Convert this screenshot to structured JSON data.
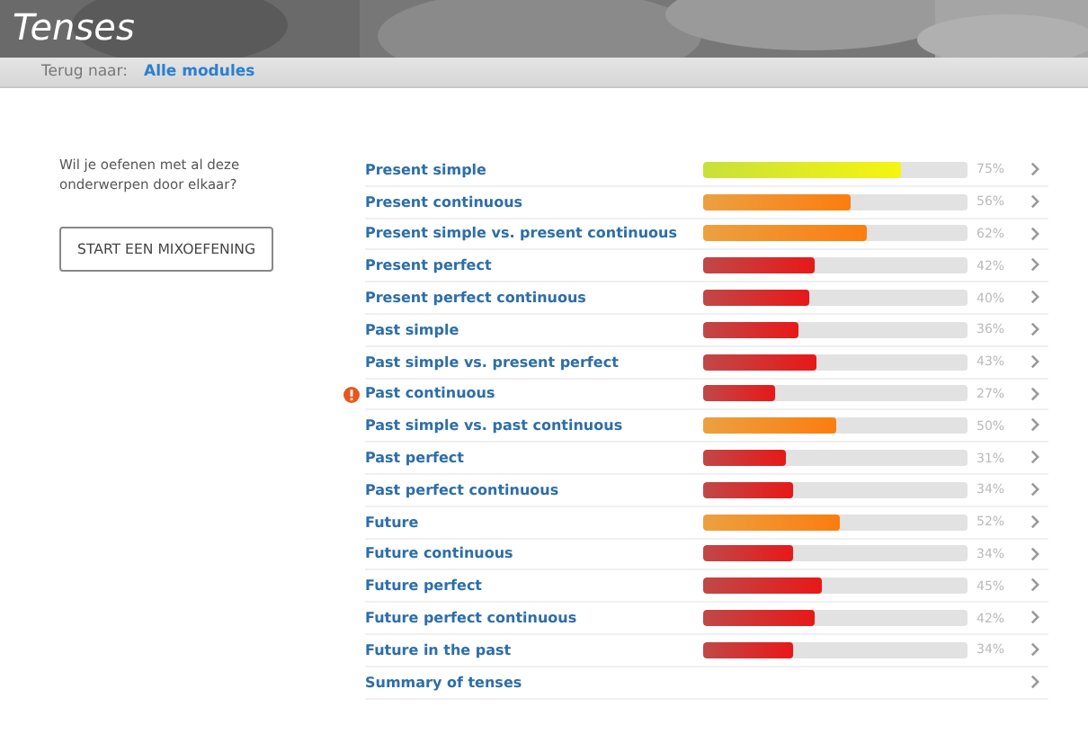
{
  "header": {
    "title": "Tenses"
  },
  "breadcrumb": {
    "label": "Terug naar:",
    "link": "Alle modules"
  },
  "intro": {
    "text": "Wil je oefenen met al deze onderwerpen door elkaar?",
    "button": "START EEN MIXOEFENING"
  },
  "topics": [
    {
      "kind": "topic",
      "name": "Present simple",
      "level": 0.75,
      "percent": "75%",
      "warning": false
    },
    {
      "kind": "topic",
      "name": "Present continuous",
      "level": 0.56,
      "percent": "56%",
      "warning": false
    },
    {
      "kind": "topic",
      "name": "Present simple vs. present continuous",
      "level": 0.62,
      "percent": "62%",
      "warning": false
    },
    {
      "kind": "topic",
      "name": "Present perfect",
      "level": 0.42,
      "percent": "42%",
      "warning": false
    },
    {
      "kind": "topic",
      "name": "Present perfect continuous",
      "level": 0.4,
      "percent": "40%",
      "warning": false
    },
    {
      "kind": "topic",
      "name": "Past simple",
      "level": 0.36,
      "percent": "36%",
      "warning": false
    },
    {
      "kind": "topic",
      "name": "Past simple vs. present perfect",
      "level": 0.43,
      "percent": "43%",
      "warning": false
    },
    {
      "kind": "topic",
      "name": "Past continuous",
      "level": 0.27,
      "percent": "27%",
      "warning": true
    },
    {
      "kind": "topic",
      "name": "Past simple vs. past continuous",
      "level": 0.5,
      "percent": "50%",
      "warning": false
    },
    {
      "kind": "topic",
      "name": "Past perfect",
      "level": 0.31,
      "percent": "31%",
      "warning": false
    },
    {
      "kind": "topic",
      "name": "Past perfect continuous",
      "level": 0.34,
      "percent": "34%",
      "warning": false
    },
    {
      "kind": "topic",
      "name": "Future",
      "level": 0.52,
      "percent": "52%",
      "warning": false
    },
    {
      "kind": "topic",
      "name": "Future continuous",
      "level": 0.34,
      "percent": "34%",
      "warning": false
    },
    {
      "kind": "topic",
      "name": "Future perfect",
      "level": 0.45,
      "percent": "45%",
      "warning": false
    },
    {
      "kind": "topic",
      "name": "Future perfect continuous",
      "level": 0.42,
      "percent": "42%",
      "warning": false
    },
    {
      "kind": "topic",
      "name": "Future in the past",
      "level": 0.34,
      "percent": "34%",
      "warning": false
    },
    {
      "kind": "summary",
      "name": "Summary of tenses"
    }
  ]
}
